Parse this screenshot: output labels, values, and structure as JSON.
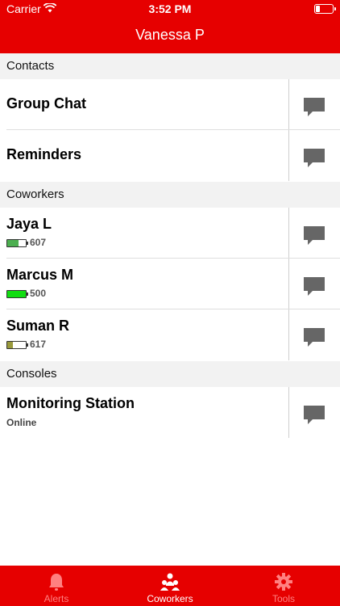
{
  "status": {
    "carrier": "Carrier",
    "time": "3:52 PM"
  },
  "header": {
    "title": "Vanessa P"
  },
  "sections": {
    "contacts": "Contacts",
    "coworkers": "Coworkers",
    "consoles": "Consoles"
  },
  "contacts": [
    {
      "label": "Group Chat"
    },
    {
      "label": "Reminders"
    }
  ],
  "coworkers": [
    {
      "name": "Jaya L",
      "value": "607",
      "battery_fraction": 0.6,
      "battery_color": "#4caf50"
    },
    {
      "name": "Marcus M",
      "value": "500",
      "battery_fraction": 1.0,
      "battery_color": "#11dd11"
    },
    {
      "name": "Suman R",
      "value": "617",
      "battery_fraction": 0.3,
      "battery_color": "#9a9a3c"
    }
  ],
  "consoles": [
    {
      "name": "Monitoring Station",
      "status": "Online"
    }
  ],
  "tabs": [
    {
      "label": "Alerts",
      "icon": "bell-icon",
      "active": false
    },
    {
      "label": "Coworkers",
      "icon": "people-icon",
      "active": true
    },
    {
      "label": "Tools",
      "icon": "gear-icon",
      "active": false
    }
  ],
  "colors": {
    "brand": "#e60000",
    "tab_inactive": "#ff8080",
    "tab_active": "#ffffff",
    "chat_icon": "#666666"
  }
}
